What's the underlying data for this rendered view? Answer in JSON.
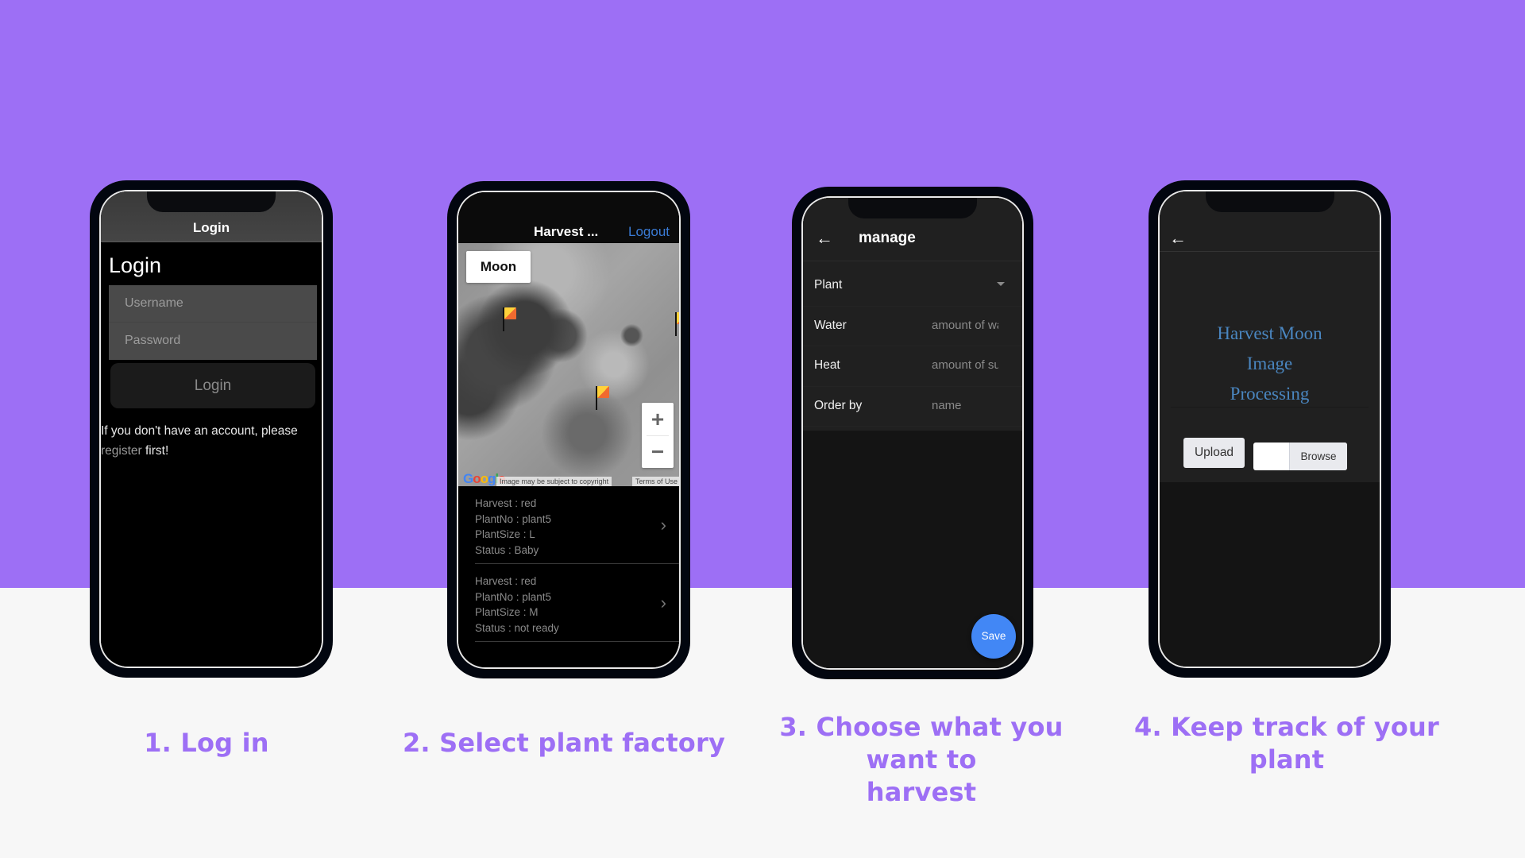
{
  "colors": {
    "background_top": "#9d6ff5",
    "background_bottom": "#f7f7f7",
    "caption": "#9d6ff5",
    "link_blue": "#3a7bd5",
    "save_button": "#4287f5",
    "title_blue": "#4a86c0"
  },
  "steps": [
    {
      "caption_lines": [
        "1. Log in"
      ],
      "screen": {
        "nav_title": "Login",
        "page_title": "Login",
        "username_placeholder": "Username",
        "password_placeholder": "Password",
        "login_button": "Login",
        "note_text": "If you don't have an account, please",
        "register_link": "register",
        "note_suffix": "first!"
      }
    },
    {
      "caption_lines": [
        "2. Select plant factory"
      ],
      "screen": {
        "nav_title": "Harvest ...",
        "logout_label": "Logout",
        "map": {
          "type_button": "Moon",
          "zoom_in": "+",
          "zoom_out": "−",
          "logo": "Google",
          "copyright": "Image may be subject to copyright",
          "terms": "Terms of Use",
          "marker_icon": "flag-icon"
        },
        "items": [
          {
            "lines": [
              "Harvest : red",
              "PlantNo : plant5",
              "PlantSize : L",
              "Status : Baby"
            ],
            "chevron": "›"
          },
          {
            "lines": [
              "Harvest : red",
              "PlantNo : plant5",
              "PlantSize : M",
              "Status : not ready"
            ],
            "chevron": "›"
          }
        ]
      }
    },
    {
      "caption_lines": [
        "3. Choose what you",
        "want to",
        "harvest"
      ],
      "screen": {
        "back_icon": "←",
        "title": "manage",
        "fields": [
          {
            "label": "Plant",
            "value": "",
            "type": "dropdown"
          },
          {
            "label": "Water",
            "value": "amount of water",
            "type": "input"
          },
          {
            "label": "Heat",
            "value": "amount of sun",
            "type": "input"
          },
          {
            "label": "Order by",
            "value": "name",
            "type": "input"
          }
        ],
        "save_button": "Save"
      }
    },
    {
      "caption_lines": [
        "4. Keep track of your plant"
      ],
      "screen": {
        "back_icon": "←",
        "title_lines": [
          "Harvest Moon",
          "Image",
          "Processing"
        ],
        "upload_button": "Upload",
        "browse_button": "Browse"
      }
    }
  ]
}
